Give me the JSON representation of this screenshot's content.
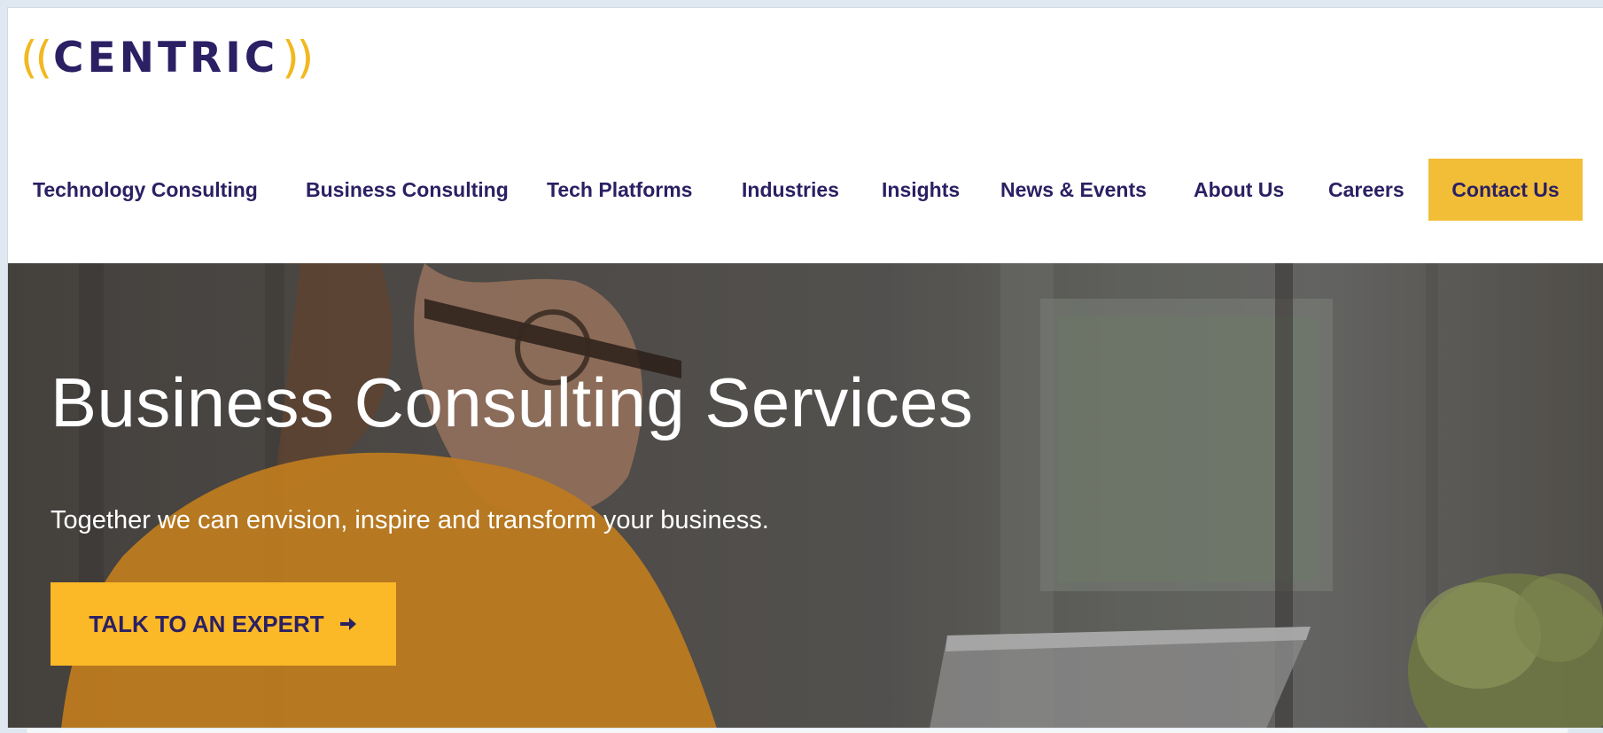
{
  "logo": {
    "left_paren": "((",
    "word": "CENTRIC",
    "right_paren": "))"
  },
  "nav": {
    "items": [
      {
        "label": "Technology Consulting"
      },
      {
        "label": "Business Consulting"
      },
      {
        "label": "Tech Platforms"
      },
      {
        "label": "Industries"
      },
      {
        "label": "Insights"
      },
      {
        "label": "News & Events"
      },
      {
        "label": "About Us"
      },
      {
        "label": "Careers"
      }
    ],
    "cta": {
      "label": "Contact Us"
    }
  },
  "hero": {
    "title": "Business Consulting Services",
    "subtitle": "Together we can envision, inspire and transform your business.",
    "button": {
      "label": "TALK TO AN EXPERT",
      "icon": "arrow-right-icon"
    }
  },
  "colors": {
    "brand_navy": "#2b2063",
    "brand_yellow": "#f2b822",
    "cta_yellow": "#fbb827"
  }
}
